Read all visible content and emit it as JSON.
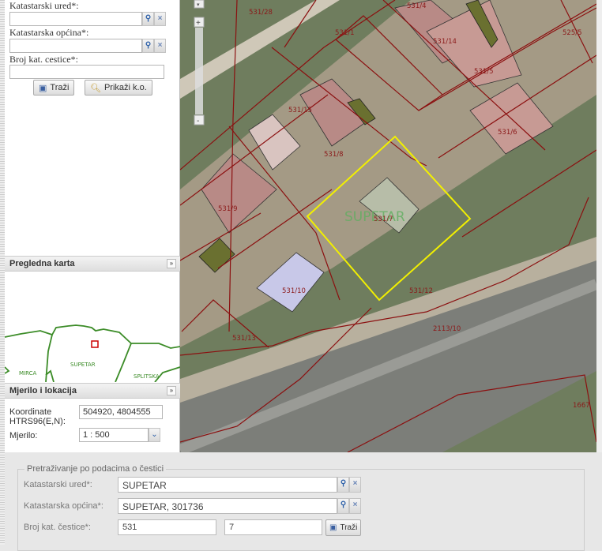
{
  "search_panel": {
    "office_label": "Katastarski ured*:",
    "office_value": "",
    "municipality_label": "Katastarska općina*:",
    "municipality_value": "",
    "parcel_label": "Broj kat. cestice*:",
    "parcel_value": "",
    "search_button": "Traži",
    "show_ko_button": "Prikaži k.o."
  },
  "overview": {
    "title": "Pregledna karta",
    "places": [
      "MIRCA",
      "SUPETAR",
      "SPLITSKA"
    ]
  },
  "scale_location": {
    "title": "Mjerilo i lokacija",
    "coords_label_1": "Koordinate",
    "coords_label_2": "HTRS96(E,N):",
    "coords_value": "504920, 4804555",
    "scale_label": "Mjerilo:",
    "scale_value": "1 : 500"
  },
  "map": {
    "highlight_label": "SUPETAR",
    "parcels": [
      "531/28",
      "531/4",
      "531/1",
      "531/14",
      "525/5",
      "531/5",
      "531/15",
      "531/6",
      "531/8",
      "531/9",
      "531/7",
      "531/10",
      "531/12",
      "2113/10",
      "531/13",
      "1667"
    ]
  },
  "parcel_search": {
    "legend": "Pretraživanje po podacima o čestici",
    "office_label": "Katastarski ured*:",
    "office_value": "SUPETAR",
    "municipality_label": "Katastarska općina*:",
    "municipality_value": "SUPETAR, 301736",
    "parcel_label": "Broj kat. čestice*:",
    "parcel_main": "531",
    "parcel_sub": "7",
    "search_button": "Traži"
  }
}
